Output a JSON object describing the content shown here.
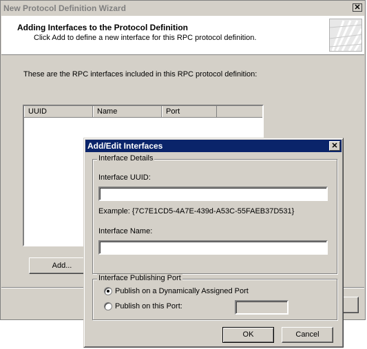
{
  "wizard": {
    "title": "New Protocol Definition Wizard",
    "close_glyph": "✕",
    "heading": "Adding Interfaces to the Protocol Definition",
    "subheading": "Click Add to define a new interface for this RPC protocol definition.",
    "intro": "These are the RPC interfaces included in this RPC protocol definition:",
    "columns": [
      "UUID",
      "Name",
      "Port"
    ],
    "add_button": "Add...",
    "graphic_icon": "wizard-banner-graphic"
  },
  "dialog": {
    "title": "Add/Edit Interfaces",
    "close_glyph": "✕",
    "details_group": "Interface Details",
    "uuid_label": "Interface UUID:",
    "uuid_value": "",
    "example": "Example: {7C7E1CD5-4A7E-439d-A53C-55FAEB37D531}",
    "name_label": "Interface Name:",
    "name_value": "",
    "port_group": "Interface Publishing Port",
    "radio_dynamic": "Publish on a Dynamically Assigned Port",
    "radio_port": "Publish on this Port:",
    "port_value": "",
    "ok_button": "OK",
    "cancel_button": "Cancel"
  },
  "colors": {
    "titlebar_active": "#0a246a",
    "face": "#d4d0c8"
  }
}
